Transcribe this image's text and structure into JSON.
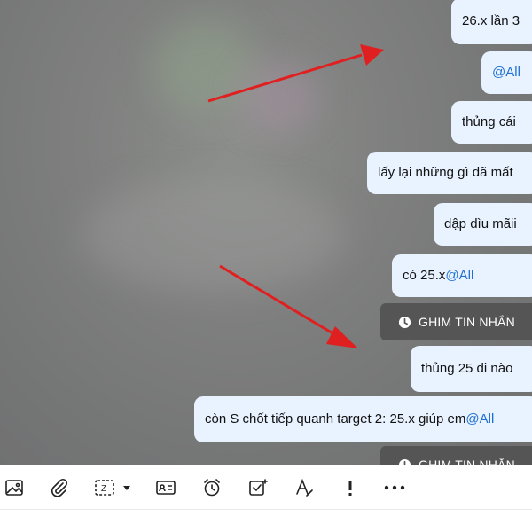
{
  "messages": [
    {
      "text": "26.x lần 3"
    },
    {
      "mention": "@All"
    },
    {
      "text": "thủng cái"
    },
    {
      "text": "lấy lại những gì đã mất"
    },
    {
      "text": "dập dìu mãii"
    },
    {
      "text": "có 25.x ",
      "mention": "@All"
    },
    {
      "text": "thủng 25 đi nào"
    },
    {
      "text": "còn S chốt tiếp quanh target 2: 25.x giúp em ",
      "mention": "@All"
    }
  ],
  "pinned_notice": {
    "label": "GHIM TIN NHẮN",
    "icon": "clock-icon"
  },
  "toolbar": {
    "icons": [
      "image-icon",
      "attachment-icon",
      "screenshot-icon",
      "contact-card-icon",
      "alarm-icon",
      "task-icon",
      "text-format-icon",
      "priority-icon",
      "more-icon"
    ]
  },
  "colors": {
    "bubble": "#e9f2ff",
    "mention": "#1d6fd1",
    "pin_pill": "#555555",
    "arrow": "#e02020"
  }
}
